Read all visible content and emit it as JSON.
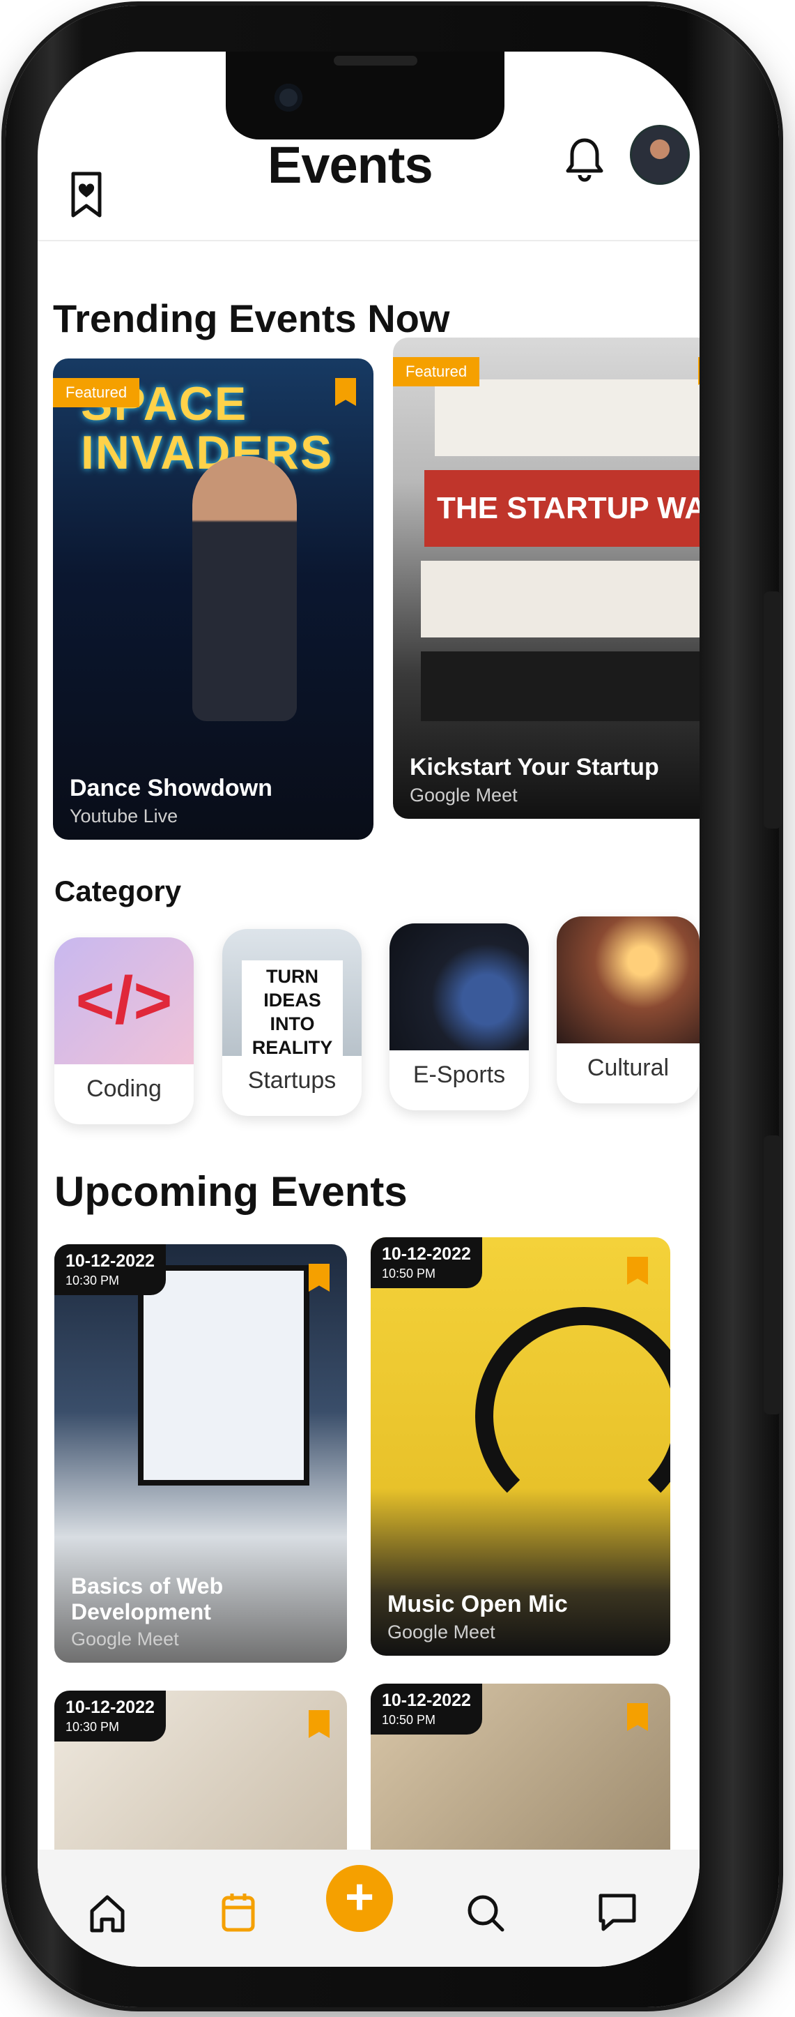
{
  "app": {
    "title": "Events"
  },
  "colors": {
    "accent": "#f5a000",
    "text": "#111111",
    "muted": "#cfcfcf"
  },
  "icons": {
    "bookmark": "bookmark-heart-icon",
    "bell": "bell-icon",
    "avatar": "user-avatar"
  },
  "trending": {
    "heading": "Trending Events Now",
    "cards": [
      {
        "badge": "Featured",
        "title": "Dance Showdown",
        "platform": "Youtube Live",
        "image_text": "SPACE INVADERS"
      },
      {
        "badge": "Featured",
        "title": "Kickstart Your Startup",
        "platform": "Google Meet",
        "image_text": "THE STARTUP WAY"
      }
    ]
  },
  "category": {
    "heading": "Category",
    "items": [
      {
        "label": "Coding",
        "image_text": "</>"
      },
      {
        "label": "Startups",
        "image_text": "TURN IDEAS INTO REALITY"
      },
      {
        "label": "E-Sports"
      },
      {
        "label": "Cultural"
      }
    ]
  },
  "upcoming": {
    "heading": "Upcoming Events",
    "cards": [
      {
        "date": "10-12-2022",
        "time": "10:30 PM",
        "title": "Basics of Web Development",
        "platform": "Google Meet"
      },
      {
        "date": "10-12-2022",
        "time": "10:50 PM",
        "title": "Music Open Mic",
        "platform": "Google Meet"
      },
      {
        "date": "10-12-2022",
        "time": "10:30 PM",
        "title": "",
        "platform": ""
      },
      {
        "date": "10-12-2022",
        "time": "10:50 PM",
        "title": "",
        "platform": ""
      }
    ]
  },
  "tabbar": {
    "items": [
      "home-icon",
      "calendar-icon",
      "add-icon",
      "search-icon",
      "chat-icon"
    ],
    "active": "calendar-icon",
    "fab_label": "+"
  }
}
